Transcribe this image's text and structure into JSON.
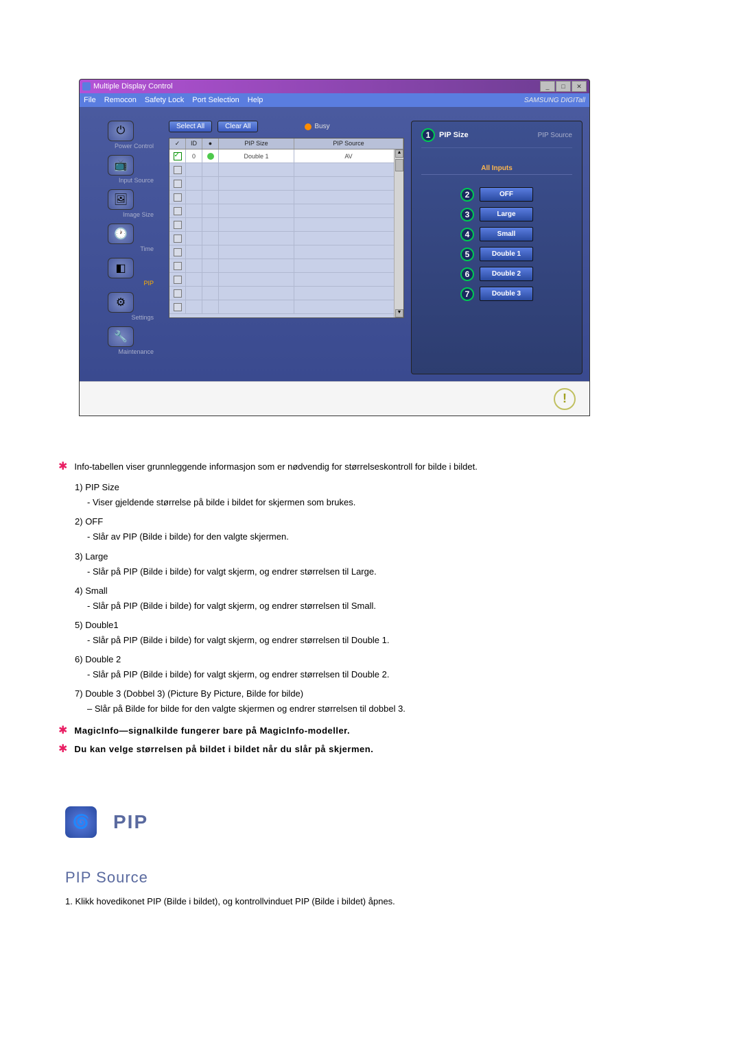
{
  "window": {
    "title": "Multiple Display Control",
    "brand": "SAMSUNG DIGITall"
  },
  "menu": {
    "file": "File",
    "remocon": "Remocon",
    "safety": "Safety Lock",
    "port": "Port Selection",
    "help": "Help"
  },
  "sidebar": {
    "power": "Power Control",
    "input": "Input Source",
    "image": "Image Size",
    "time": "Time",
    "pip": "PIP",
    "settings": "Settings",
    "maintenance": "Maintenance"
  },
  "toolbar": {
    "select_all": "Select All",
    "clear_all": "Clear All",
    "busy": "Busy"
  },
  "grid": {
    "headers": {
      "check": "✓",
      "id": "ID",
      "status": "●",
      "pip_size": "PIP Size",
      "pip_source": "PIP Source"
    },
    "row1": {
      "id": "0",
      "pip_size": "Double 1",
      "pip_source": "AV"
    }
  },
  "right_panel": {
    "title": "PIP Size",
    "sub": "PIP Source",
    "section": "All Inputs",
    "buttons": {
      "off": "OFF",
      "large": "Large",
      "small": "Small",
      "double1": "Double 1",
      "double2": "Double 2",
      "double3": "Double 3"
    },
    "callouts": {
      "n1": "1",
      "n2": "2",
      "n3": "3",
      "n4": "4",
      "n5": "5",
      "n6": "6",
      "n7": "7"
    }
  },
  "desc": {
    "intro": "Info-tabellen viser grunnleggende informasjon som er nødvendig for størrelseskontroll for bilde i bildet.",
    "items": [
      {
        "num": "1)",
        "title": "PIP Size",
        "text": "- Viser gjeldende størrelse på bilde i bildet for skjermen som brukes."
      },
      {
        "num": "2)",
        "title": "OFF",
        "text": "- Slår av PIP (Bilde i bilde) for den valgte skjermen."
      },
      {
        "num": "3)",
        "title": "Large",
        "text": "- Slår på PIP (Bilde i bilde) for valgt skjerm, og endrer størrelsen til Large."
      },
      {
        "num": "4)",
        "title": "Small",
        "text": "- Slår på PIP (Bilde i bilde) for valgt skjerm, og endrer størrelsen til Small."
      },
      {
        "num": "5)",
        "title": "Double1",
        "text": "- Slår på PIP (Bilde i bilde) for valgt skjerm, og endrer størrelsen til Double 1."
      },
      {
        "num": "6)",
        "title": "Double 2",
        "text": "- Slår på PIP (Bilde i bilde) for valgt skjerm, og endrer størrelsen til Double 2."
      },
      {
        "num": "7)",
        "title": "Double 3 (Dobbel 3) (Picture By Picture, Bilde for bilde)",
        "text": "– Slår på Bilde for bilde for den valgte skjermen og endrer størrelsen til dobbel 3."
      }
    ],
    "note1": "MagicInfo—signalkilde fungerer bare på MagicInfo-modeller.",
    "note2": "Du kan velge størrelsen på bildet i bildet når du slår på skjermen."
  },
  "pip_section": {
    "heading": "PIP",
    "sub_heading": "PIP Source",
    "step1": "1.  Klikk hovedikonet PIP (Bilde i bildet), og kontrollvinduet PIP (Bilde i bildet) åpnes."
  }
}
